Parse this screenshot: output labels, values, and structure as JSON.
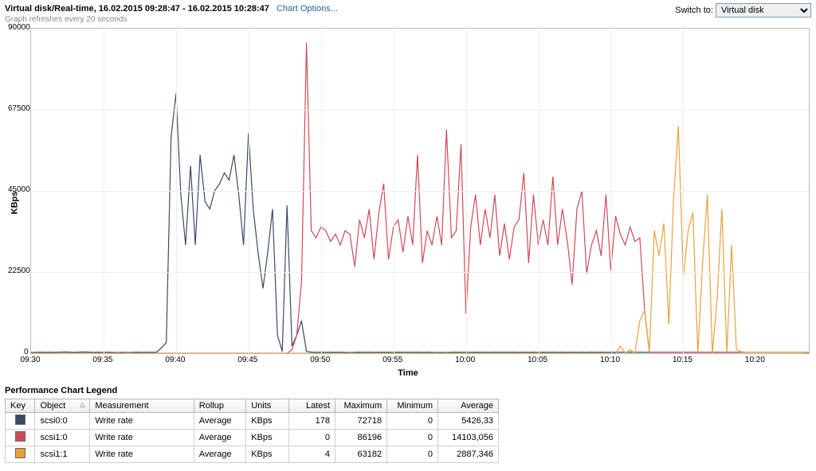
{
  "header": {
    "title": "Virtual disk/Real-time, 16.02.2015 09:28:47 - 16.02.2015 10:28:47",
    "chart_options_label": "Chart Options...",
    "refresh_note": "Graph refreshes every 20 seconds",
    "switch_label": "Switch to:",
    "switch_selected": "Virtual disk"
  },
  "legend": {
    "title": "Performance Chart Legend",
    "columns": {
      "key": "Key",
      "object": "Object",
      "measurement": "Measurement",
      "rollup": "Rollup",
      "units": "Units",
      "latest": "Latest",
      "maximum": "Maximum",
      "minimum": "Minimum",
      "average": "Average"
    },
    "rows": [
      {
        "color": "#3d4a63",
        "object": "scsi0:0",
        "measurement": "Write rate",
        "rollup": "Average",
        "units": "KBps",
        "latest": "178",
        "maximum": "72718",
        "minimum": "0",
        "average": "5426,33"
      },
      {
        "color": "#cf4a57",
        "object": "scsi1:0",
        "measurement": "Write rate",
        "rollup": "Average",
        "units": "KBps",
        "latest": "0",
        "maximum": "86196",
        "minimum": "0",
        "average": "14103,056"
      },
      {
        "color": "#e7a23a",
        "object": "scsi1:1",
        "measurement": "Write rate",
        "rollup": "Average",
        "units": "KBps",
        "latest": "4",
        "maximum": "63182",
        "minimum": "0",
        "average": "2887,346"
      }
    ]
  },
  "chart_data": {
    "type": "line",
    "title": "",
    "xlabel": "Time",
    "ylabel": "KBps",
    "x_ticks": [
      "09:30",
      "09:35",
      "09:40",
      "09:45",
      "09:50",
      "09:55",
      "10:00",
      "10:05",
      "10:10",
      "10:15",
      "10:20"
    ],
    "ylim": [
      0,
      90000
    ],
    "y_ticks": [
      0,
      22500,
      45000,
      67500,
      90000
    ],
    "x_minutes": [
      0,
      0.33,
      0.66,
      1,
      1.33,
      1.66,
      2,
      2.33,
      2.66,
      3,
      3.33,
      3.66,
      4,
      4.33,
      4.66,
      5,
      5.33,
      5.66,
      6,
      6.33,
      6.66,
      7,
      7.33,
      7.66,
      8,
      8.33,
      8.66,
      9,
      9.33,
      9.66,
      10,
      10.33,
      10.66,
      11,
      11.33,
      11.66,
      12,
      12.33,
      12.66,
      13,
      13.33,
      13.66,
      14,
      14.33,
      14.66,
      15,
      15.33,
      15.66,
      16,
      16.33,
      16.66,
      17,
      17.33,
      17.66,
      18,
      18.33,
      18.66,
      19,
      19.33,
      19.66,
      20,
      20.33,
      20.66,
      21,
      21.33,
      21.66,
      22,
      22.33,
      22.66,
      23,
      23.33,
      23.66,
      24,
      24.33,
      24.66,
      25,
      25.33,
      25.66,
      26,
      26.33,
      26.66,
      27,
      27.33,
      27.66,
      28,
      28.33,
      28.66,
      29,
      29.33,
      29.66,
      30,
      30.33,
      30.66,
      31,
      31.33,
      31.66,
      32,
      32.33,
      32.66,
      33,
      33.33,
      33.66,
      34,
      34.33,
      34.66,
      35,
      35.33,
      35.66,
      36,
      36.33,
      36.66,
      37,
      37.33,
      37.66,
      38,
      38.33,
      38.66,
      39,
      39.33,
      39.66,
      40,
      40.33,
      40.66,
      41,
      41.33,
      41.66,
      42,
      42.33,
      42.66,
      43,
      43.33,
      43.66,
      44,
      44.33,
      44.66,
      45,
      45.33,
      45.66,
      46,
      46.33,
      46.66,
      47,
      47.33,
      47.66,
      48,
      48.33,
      48.66,
      49,
      49.33,
      49.66,
      50,
      50.33,
      50.66,
      51,
      51.33,
      51.66,
      52,
      52.33,
      52.66,
      53,
      53.33,
      53.66
    ],
    "series": [
      {
        "name": "scsi0:0",
        "color": "#3d4a63",
        "values": [
          200,
          250,
          300,
          250,
          300,
          250,
          300,
          350,
          300,
          250,
          300,
          350,
          300,
          250,
          300,
          250,
          300,
          250,
          200,
          250,
          200,
          250,
          300,
          250,
          300,
          250,
          300,
          1500,
          3000,
          60000,
          72000,
          44000,
          30000,
          52000,
          30000,
          55000,
          42000,
          40000,
          45000,
          47000,
          50000,
          48000,
          55000,
          44000,
          30000,
          61000,
          40000,
          28000,
          18000,
          28000,
          40000,
          5000,
          500,
          41000,
          2000,
          5000,
          9000,
          500,
          300,
          250,
          300,
          250,
          300,
          250,
          300,
          250,
          200,
          250,
          300,
          250,
          300,
          250,
          300,
          250,
          300,
          250,
          300,
          250,
          300,
          250,
          300,
          250,
          300,
          250,
          200,
          250,
          200,
          250,
          300,
          250,
          300,
          250,
          300,
          250,
          300,
          250,
          300,
          250,
          300,
          250,
          300,
          250,
          300,
          250,
          300,
          250,
          300,
          250,
          300,
          250,
          300,
          250,
          300,
          250,
          300,
          250,
          300,
          250,
          300,
          250,
          300,
          250,
          300,
          250,
          300,
          250,
          300,
          250,
          300,
          250,
          300,
          250,
          300,
          250,
          300,
          250,
          300,
          250,
          300,
          250,
          300,
          250,
          300,
          250,
          300,
          250,
          300,
          250,
          300,
          250,
          300,
          250,
          300,
          250,
          300,
          250,
          300,
          250,
          300,
          250,
          300,
          178
        ]
      },
      {
        "name": "scsi1:0",
        "color": "#cf4a57",
        "values": [
          0,
          0,
          0,
          0,
          0,
          0,
          0,
          0,
          0,
          0,
          0,
          0,
          0,
          0,
          0,
          0,
          0,
          0,
          0,
          0,
          0,
          0,
          0,
          0,
          0,
          0,
          0,
          0,
          0,
          0,
          0,
          0,
          0,
          0,
          0,
          0,
          0,
          0,
          0,
          0,
          0,
          0,
          0,
          0,
          0,
          0,
          0,
          0,
          0,
          0,
          0,
          0,
          0,
          0,
          1000,
          5000,
          20000,
          86000,
          34000,
          32000,
          35000,
          34000,
          31000,
          33000,
          30000,
          34000,
          33000,
          24000,
          37000,
          32000,
          40000,
          26000,
          39000,
          47000,
          26000,
          35000,
          37000,
          28000,
          38000,
          30000,
          55000,
          25000,
          34000,
          30000,
          38000,
          30000,
          62000,
          32000,
          34000,
          58000,
          11000,
          35000,
          44000,
          30000,
          40000,
          32000,
          44000,
          27000,
          36000,
          26000,
          35000,
          37000,
          50000,
          25000,
          44000,
          30000,
          37000,
          30000,
          49000,
          30000,
          40000,
          31000,
          19000,
          40000,
          45000,
          22000,
          30000,
          34000,
          27000,
          44000,
          23000,
          38000,
          33000,
          30000,
          35000,
          31000,
          32000,
          12000,
          300,
          300,
          250,
          300,
          250,
          300,
          250,
          300,
          250,
          300,
          250,
          300,
          250,
          300,
          250,
          300,
          250,
          300,
          250,
          300,
          250,
          300,
          250,
          300,
          250,
          300,
          250,
          300,
          250,
          300,
          250,
          300,
          250,
          0
        ]
      },
      {
        "name": "scsi1:1",
        "color": "#e7a23a",
        "values": [
          0,
          0,
          0,
          0,
          0,
          0,
          0,
          0,
          0,
          0,
          0,
          0,
          0,
          0,
          0,
          0,
          0,
          0,
          0,
          0,
          0,
          0,
          0,
          0,
          0,
          0,
          0,
          0,
          0,
          0,
          0,
          0,
          0,
          0,
          0,
          0,
          0,
          0,
          0,
          0,
          0,
          0,
          0,
          0,
          0,
          0,
          0,
          0,
          0,
          0,
          0,
          0,
          0,
          0,
          0,
          0,
          0,
          0,
          0,
          0,
          0,
          0,
          0,
          0,
          0,
          0,
          0,
          0,
          0,
          0,
          0,
          0,
          0,
          0,
          0,
          0,
          0,
          0,
          0,
          0,
          0,
          0,
          0,
          0,
          0,
          0,
          0,
          0,
          0,
          0,
          0,
          0,
          0,
          0,
          0,
          0,
          0,
          0,
          0,
          0,
          0,
          0,
          0,
          0,
          0,
          0,
          0,
          0,
          0,
          0,
          0,
          0,
          0,
          0,
          0,
          0,
          0,
          0,
          0,
          0,
          0,
          0,
          2000,
          0,
          1000,
          0,
          9000,
          12000,
          500,
          34000,
          27000,
          36000,
          8000,
          43000,
          63000,
          21000,
          34000,
          39000,
          0,
          25000,
          44000,
          0,
          15000,
          40000,
          0,
          30000,
          1000,
          400,
          300,
          250,
          300,
          250,
          300,
          250,
          300,
          250,
          300,
          250,
          300,
          250,
          300,
          4
        ]
      }
    ]
  }
}
